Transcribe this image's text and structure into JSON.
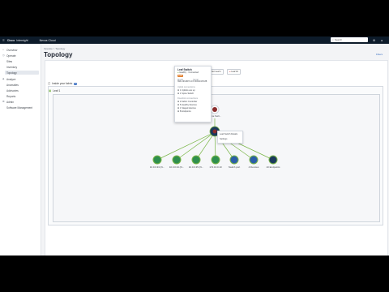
{
  "topbar": {
    "brand": "Cisco",
    "product": "Intersight",
    "org": "Nexus Cloud",
    "search_placeholder": "Search"
  },
  "sidebar": {
    "items": [
      {
        "label": "Overview",
        "active": false
      },
      {
        "label": "Operate",
        "active": false
      },
      {
        "label": "Sites",
        "active": false
      },
      {
        "label": "Inventory",
        "active": false
      },
      {
        "label": "Topology",
        "active": true
      },
      {
        "label": "Analyze",
        "active": false
      },
      {
        "label": "Anomalies",
        "active": false
      },
      {
        "label": "Advisories",
        "active": false
      },
      {
        "label": "Reports",
        "active": false
      },
      {
        "label": "Admin",
        "active": false
      },
      {
        "label": "Software Management",
        "active": false
      }
    ]
  },
  "main": {
    "breadcrumb": "Operate  >  Topology",
    "title": "Topology",
    "right_link": "Filters",
    "fabric_label": "Inside your fabric",
    "fabric_count": "1",
    "leaf_label": "Leaf 1",
    "buttons": {
      "filter": "Filter Leaf 1",
      "count": "Leaf 10"
    }
  },
  "popup": {
    "title": "Leaf Switch",
    "subtitle": "Healthy · Connected",
    "tag": "Leaf",
    "label1": "Model",
    "label2": "Serial",
    "model": "N9K-C93180YC-FX",
    "serial": "FDO2134TL8B",
    "section1": "Uplink connections",
    "uplinks": [
      "1 Uplinks are up",
      "1 Spine Switch"
    ],
    "section2": "Downlink connections",
    "downlinks": [
      "2 Fabric Controller",
      "5 Healthy Devices",
      "1 Staged devices",
      "8 Endpoints"
    ]
  },
  "tooltip": {
    "title": "Leaf Switch Details",
    "sub": "Settings"
  },
  "nodes": [
    {
      "label": "10.0.0.33 (N..."
    },
    {
      "label": "10.0.0.34 (N..."
    },
    {
      "label": "10.0.0.35 (N..."
    },
    {
      "label": "172.16.0.10"
    },
    {
      "label": "Switch port"
    },
    {
      "label": "4 Devices"
    },
    {
      "label": "10 Endpoints"
    }
  ],
  "top_node": {
    "label": "Spine Swit..."
  },
  "colors": {
    "accent": "#3b6fc1",
    "healthy": "#7ab648",
    "node": "#2f8f4e",
    "blue_node": "#2c5fa8",
    "dark_node": "#1b3a5c"
  }
}
